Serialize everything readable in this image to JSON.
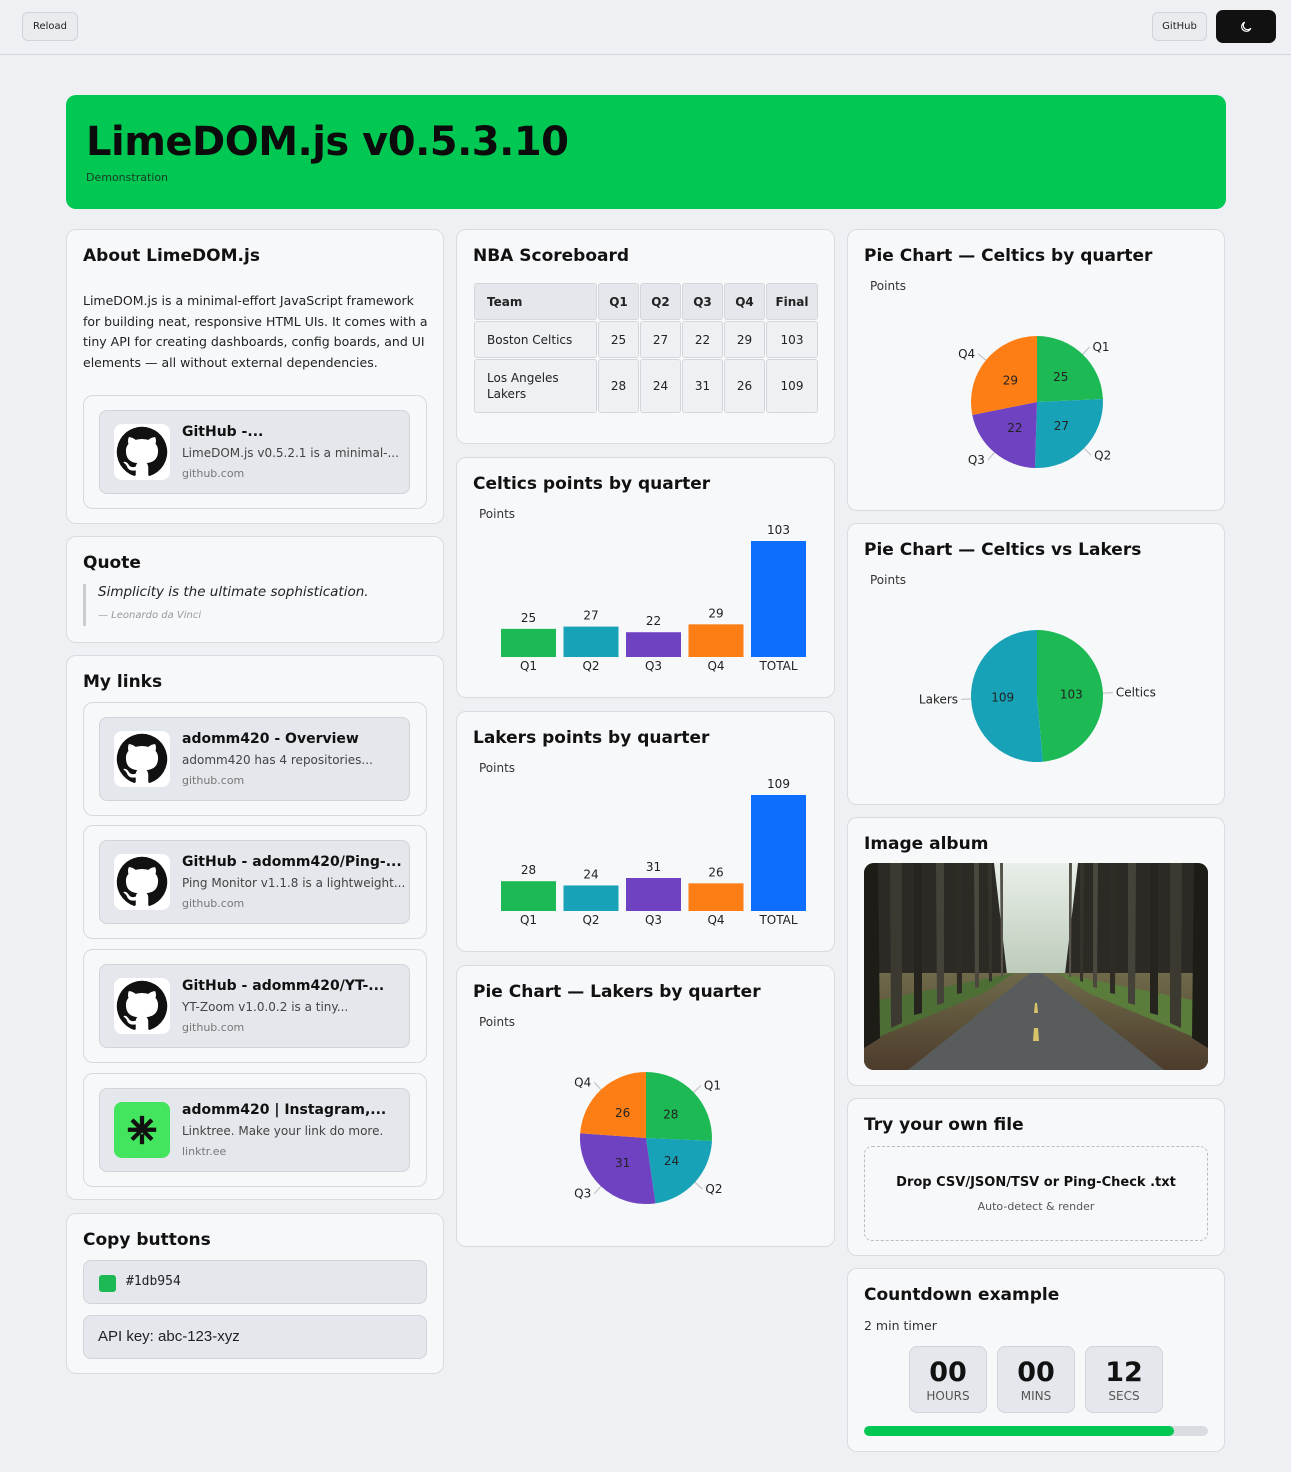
{
  "topbar": {
    "reload_label": "Reload",
    "github_label": "GitHub",
    "theme_icon": "moon-icon"
  },
  "hero": {
    "title": "LimeDOM.js v0.5.3.10",
    "subtitle": "Demonstration",
    "color": "#00c853"
  },
  "about": {
    "title": "About LimeDOM.js",
    "text": "LimeDOM.js is a minimal-effort JavaScript framework for building neat, responsive HTML UIs. It comes with a tiny API for creating dashboards, config boards, and UI elements — all without external dependencies.",
    "link": {
      "title": "GitHub -...",
      "desc": "LimeDOM.js v0.5.2.1 is a minimal-...",
      "domain": "github.com",
      "icon": "github-icon"
    }
  },
  "quote": {
    "title": "Quote",
    "text": "Simplicity is the ultimate sophistication.",
    "author": "— Leonardo da Vinci"
  },
  "links": {
    "title": "My links",
    "items": [
      {
        "title": "adomm420 - Overview",
        "desc": "adomm420 has 4 repositories...",
        "domain": "github.com",
        "icon": "github-icon"
      },
      {
        "title": "GitHub - adomm420/Ping-...",
        "desc": "Ping Monitor v1.1.8 is a lightweight...",
        "domain": "github.com",
        "icon": "github-icon"
      },
      {
        "title": "GitHub - adomm420/YT-...",
        "desc": "YT-Zoom v1.0.0.2 is a tiny...",
        "domain": "github.com",
        "icon": "github-icon"
      },
      {
        "title": "adomm420 | Instagram,...",
        "desc": "Linktree. Make your link do more.",
        "domain": "linktr.ee",
        "icon": "linktree-icon"
      }
    ]
  },
  "copy": {
    "title": "Copy buttons",
    "color_value": "#1db954",
    "api_text": "API key: abc-123-xyz"
  },
  "scoreboard": {
    "title": "NBA Scoreboard",
    "headers": [
      "Team",
      "Q1",
      "Q2",
      "Q3",
      "Q4",
      "Final"
    ],
    "rows": [
      [
        "Boston Celtics",
        "25",
        "27",
        "22",
        "29",
        "103"
      ],
      [
        "Los Angeles Lakers",
        "28",
        "24",
        "31",
        "26",
        "109"
      ]
    ]
  },
  "chart_data": [
    {
      "type": "bar",
      "title": "Celtics points by quarter",
      "ylabel": "Points",
      "categories": [
        "Q1",
        "Q2",
        "Q3",
        "Q4",
        "TOTAL"
      ],
      "values": [
        25,
        27,
        22,
        29,
        103
      ],
      "colors": [
        "#1db954",
        "#17a2b8",
        "#6f42c1",
        "#fd7e14",
        "#0d6efd"
      ]
    },
    {
      "type": "bar",
      "title": "Lakers points by quarter",
      "ylabel": "Points",
      "categories": [
        "Q1",
        "Q2",
        "Q3",
        "Q4",
        "TOTAL"
      ],
      "values": [
        28,
        24,
        31,
        26,
        109
      ],
      "colors": [
        "#1db954",
        "#17a2b8",
        "#6f42c1",
        "#fd7e14",
        "#0d6efd"
      ]
    },
    {
      "type": "pie",
      "title": "Pie Chart — Lakers by quarter",
      "ylabel": "Points",
      "categories": [
        "Q1",
        "Q2",
        "Q3",
        "Q4"
      ],
      "values": [
        28,
        24,
        31,
        26
      ],
      "colors": [
        "#1db954",
        "#17a2b8",
        "#6f42c1",
        "#fd7e14"
      ]
    },
    {
      "type": "pie",
      "title": "Pie Chart — Celtics by quarter",
      "ylabel": "Points",
      "categories": [
        "Q1",
        "Q2",
        "Q3",
        "Q4"
      ],
      "values": [
        25,
        27,
        22,
        29
      ],
      "colors": [
        "#1db954",
        "#17a2b8",
        "#6f42c1",
        "#fd7e14"
      ]
    },
    {
      "type": "pie",
      "title": "Pie Chart — Celtics vs Lakers",
      "ylabel": "Points",
      "categories": [
        "Celtics",
        "Lakers"
      ],
      "values": [
        103,
        109
      ],
      "colors": [
        "#1db954",
        "#17a2b8"
      ]
    }
  ],
  "album": {
    "title": "Image album"
  },
  "upload": {
    "title": "Try your own file",
    "drop_text": "Drop CSV/JSON/TSV or Ping-Check .txt",
    "hint": "Auto-detect & render"
  },
  "countdown": {
    "title": "Countdown example",
    "subtitle": "2 min timer",
    "hours": "00",
    "mins": "00",
    "secs": "12",
    "hours_label": "HOURS",
    "mins_label": "MINS",
    "secs_label": "SECS",
    "progress": 0.9
  }
}
